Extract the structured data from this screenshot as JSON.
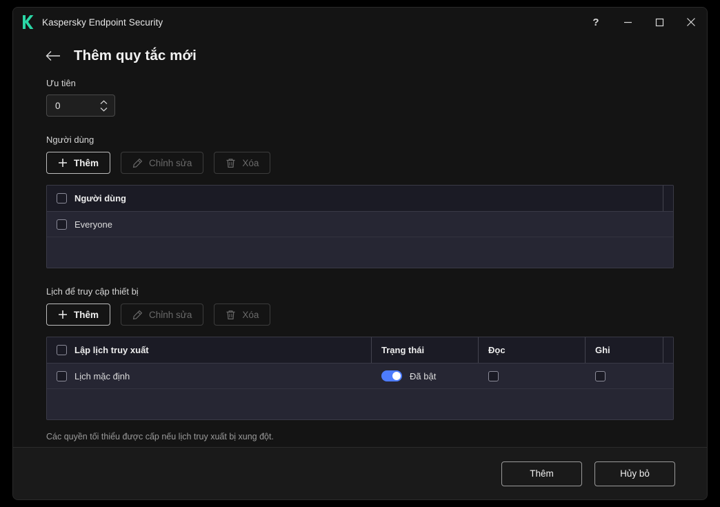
{
  "window": {
    "app_title": "Kaspersky Endpoint Security",
    "logo_icon": "kaspersky-k-logo",
    "logo_color": "#2ad6a5",
    "controls": {
      "help": "?",
      "minimize": "minimize-icon",
      "maximize": "maximize-icon",
      "close": "close-icon"
    }
  },
  "header": {
    "back_icon": "arrow-left-icon",
    "title": "Thêm quy tắc mới"
  },
  "priority": {
    "label": "Ưu tiên",
    "value": "0",
    "placeholder": "0",
    "spinner_up_icon": "chevron-up-icon",
    "spinner_down_icon": "chevron-down-icon"
  },
  "users": {
    "label": "Người dùng",
    "buttons": [
      {
        "label": "Thêm",
        "icon": "plus-icon",
        "enabled": true
      },
      {
        "label": "Chỉnh sửa",
        "icon": "pencil-icon",
        "enabled": false
      },
      {
        "label": "Xóa",
        "icon": "trash-icon",
        "enabled": false
      }
    ],
    "table": {
      "columns": [
        "Người dùng"
      ],
      "rows": [
        {
          "name": "Everyone",
          "checked": false
        }
      ],
      "header_checked": false
    }
  },
  "schedule": {
    "label": "Lịch để truy cập thiết bị",
    "buttons": [
      {
        "label": "Thêm",
        "icon": "plus-icon",
        "enabled": true
      },
      {
        "label": "Chỉnh sửa",
        "icon": "pencil-icon",
        "enabled": false
      },
      {
        "label": "Xóa",
        "icon": "trash-icon",
        "enabled": false
      }
    ],
    "table": {
      "columns": [
        "Lập lịch truy xuất",
        "Trạng thái",
        "Đọc",
        "Ghi"
      ],
      "rows": [
        {
          "name": "Lịch mặc định",
          "checked": false,
          "status_on": true,
          "status_label": "Đã bật",
          "read_checked": false,
          "write_checked": false
        }
      ],
      "header_checked": false
    }
  },
  "hint": "Các quyền tối thiểu được cấp nếu lịch truy xuất bị xung đột.",
  "footer": {
    "primary": "Thêm",
    "secondary": "Hủy bỏ"
  },
  "colors": {
    "accent_toggle": "#4d7cfe",
    "brand": "#2ad6a5",
    "table_header_bg": "#1b1b25",
    "table_row_bg": "#262633"
  }
}
